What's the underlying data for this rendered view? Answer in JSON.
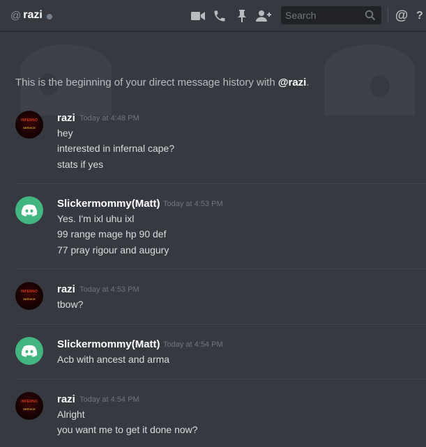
{
  "header": {
    "at_symbol": "@",
    "username": "razi",
    "search_placeholder": "Search",
    "mention_symbol": "@",
    "help_symbol": "?"
  },
  "intro": {
    "prefix": "This is the beginning of your direct message history with ",
    "handle": "@razi",
    "suffix": "."
  },
  "messages": [
    {
      "author": "razi",
      "timestamp": "Today at 4:48 PM",
      "avatar_text": [
        "INFERNO",
        "SERVICE"
      ],
      "lines": [
        "hey",
        "interested in infernal cape?",
        "stats if yes"
      ]
    },
    {
      "author": "Slickermommy(Matt)",
      "timestamp": "Today at 4:53 PM",
      "lines": [
        "Yes. I'm ixl uhu ixl",
        "99 range mage hp 90 def",
        "77 pray rigour and augury"
      ]
    },
    {
      "author": "razi",
      "timestamp": "Today at 4:53 PM",
      "avatar_text": [
        "INFERNO",
        "SERVICE"
      ],
      "lines": [
        "tbow?"
      ]
    },
    {
      "author": "Slickermommy(Matt)",
      "timestamp": "Today at 4:54 PM",
      "lines": [
        "Acb with ancest and arma"
      ]
    },
    {
      "author": "razi",
      "timestamp": "Today at 4:54 PM",
      "avatar_text": [
        "INFERNO",
        "SERVICE"
      ],
      "lines": [
        "Alright",
        "you want me to get it done now?"
      ]
    }
  ],
  "colors": {
    "background": "#36393f",
    "discord_green": "#43b581",
    "status_offline": "#747f8d"
  },
  "icons": [
    "video-call-icon",
    "voice-call-icon",
    "pin-icon",
    "add-friend-icon",
    "search-icon",
    "mention-icon",
    "help-icon",
    "discord-logo-icon"
  ]
}
